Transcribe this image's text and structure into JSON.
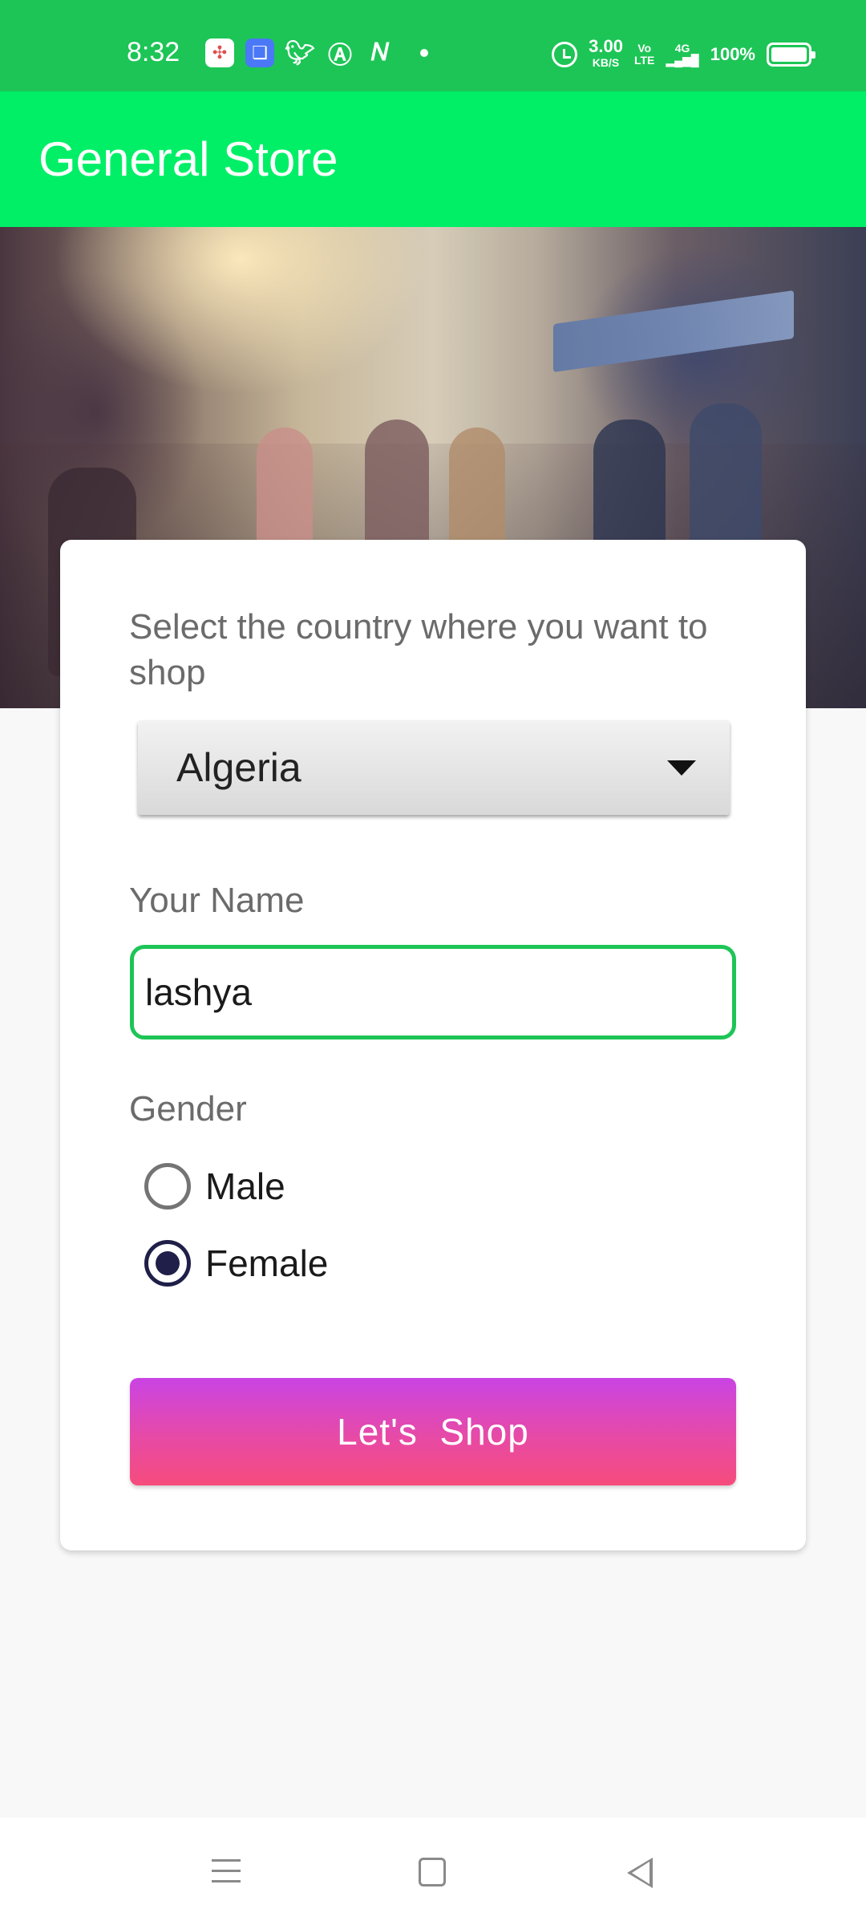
{
  "status_bar": {
    "time": "8:32",
    "net_speed": "3.00",
    "net_speed_unit": "KB/S",
    "volte": "Vo\nLTE",
    "network": "4G",
    "battery": "100%",
    "icons": [
      "app-icon",
      "app-icon",
      "twitter-icon",
      "app-icon",
      "app-icon",
      "dot-icon",
      "alarm-icon",
      "signal-icon",
      "battery-icon"
    ]
  },
  "app_bar": {
    "title": "General Store"
  },
  "form": {
    "country_label": "Select the country where you want to shop",
    "country_value": "Algeria",
    "name_label": "Your Name",
    "name_value": "lashya",
    "gender_label": "Gender",
    "gender_options": [
      {
        "label": "Male",
        "checked": false
      },
      {
        "label": "Female",
        "checked": true
      }
    ],
    "submit_label": "Let's  Shop"
  },
  "colors": {
    "status_bar": "#1dc556",
    "app_bar": "#00ef67",
    "input_focus": "#1dc556",
    "button_top": "#c944e4",
    "button_bottom": "#f64c7c",
    "radio_checked": "#1f1f49"
  }
}
